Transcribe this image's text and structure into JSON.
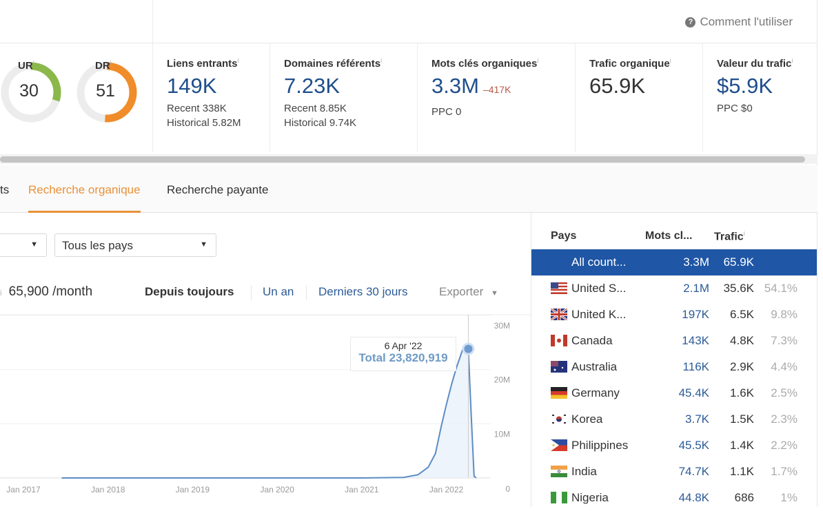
{
  "header": {
    "help_label": "Comment l'utiliser",
    "help_icon": "question-circle-icon"
  },
  "metrics": {
    "ur": {
      "label": "UR",
      "value": "30",
      "fraction": 0.3,
      "color": "#8bb84a"
    },
    "dr": {
      "label": "DR",
      "value": "51",
      "fraction": 0.51,
      "color": "#f08c2a"
    },
    "backlinks": {
      "label": "Liens entrants",
      "value": "149K",
      "recent": "Recent 338K",
      "historical": "Historical 5.82M"
    },
    "ref_domains": {
      "label": "Domaines référents",
      "value": "7.23K",
      "recent": "Recent 8.85K",
      "historical": "Historical 9.74K"
    },
    "organic_keywords": {
      "label": "Mots clés organiques",
      "value": "3.3M",
      "delta": "–417K",
      "ppc": "PPC 0"
    },
    "organic_traffic": {
      "label": "Trafic organique",
      "value": "65.9K"
    },
    "traffic_value": {
      "label": "Valeur du trafic",
      "value": "$5.9K",
      "ppc": "PPC $0"
    }
  },
  "tabs": [
    {
      "label": "ts"
    },
    {
      "label": "Recherche organique",
      "active": true
    },
    {
      "label": "Recherche payante"
    }
  ],
  "filters": {
    "country_select": "Tous les pays"
  },
  "summary": {
    "traffic": "65,900 /month"
  },
  "periods": {
    "all": "Depuis toujours",
    "year": "Un an",
    "days30": "Derniers 30 jours",
    "export": "Exporter"
  },
  "chart_data": {
    "type": "area",
    "x_tick_labels": [
      "Jan 2017",
      "Jan 2018",
      "Jan 2019",
      "Jan 2020",
      "Jan 2021",
      "Jan 2022"
    ],
    "y_tick_labels": [
      "0",
      "10M",
      "20M",
      "30M"
    ],
    "ylim": [
      0,
      30000000
    ],
    "grid": true,
    "color": "#5b8cc4",
    "tooltip": {
      "date": "6 Apr '22",
      "text": "Total 23,820,919"
    },
    "points": [
      [
        "2017-06-15",
        0
      ],
      [
        "2019-01-01",
        0
      ],
      [
        "2021-01-01",
        0
      ],
      [
        "2021-07-01",
        100000
      ],
      [
        "2021-09-01",
        600000
      ],
      [
        "2021-10-15",
        2000000
      ],
      [
        "2021-11-15",
        4500000
      ],
      [
        "2021-12-10",
        9500000
      ],
      [
        "2022-01-01",
        13500000
      ],
      [
        "2022-01-25",
        17500000
      ],
      [
        "2022-02-15",
        20500000
      ],
      [
        "2022-03-15",
        24000000
      ],
      [
        "2022-04-06",
        23820919
      ],
      [
        "2022-04-18",
        12000000
      ],
      [
        "2022-05-01",
        300000
      ],
      [
        "2022-05-10",
        0
      ]
    ]
  },
  "countries": {
    "headers": {
      "country": "Pays",
      "keywords": "Mots cl...",
      "traffic": "Trafic"
    },
    "rows": [
      {
        "name": "All count...",
        "keywords": "3.3M",
        "traffic": "65.9K",
        "pct": "",
        "flag": "none"
      },
      {
        "name": "United S...",
        "keywords": "2.1M",
        "traffic": "35.6K",
        "pct": "54.1%",
        "flag": "us"
      },
      {
        "name": "United K...",
        "keywords": "197K",
        "traffic": "6.5K",
        "pct": "9.8%",
        "flag": "uk"
      },
      {
        "name": "Canada",
        "keywords": "143K",
        "traffic": "4.8K",
        "pct": "7.3%",
        "flag": "ca"
      },
      {
        "name": "Australia",
        "keywords": "116K",
        "traffic": "2.9K",
        "pct": "4.4%",
        "flag": "au"
      },
      {
        "name": "Germany",
        "keywords": "45.4K",
        "traffic": "1.6K",
        "pct": "2.5%",
        "flag": "de"
      },
      {
        "name": "Korea",
        "keywords": "3.7K",
        "traffic": "1.5K",
        "pct": "2.3%",
        "flag": "kr"
      },
      {
        "name": "Philippines",
        "keywords": "45.5K",
        "traffic": "1.4K",
        "pct": "2.2%",
        "flag": "ph"
      },
      {
        "name": "India",
        "keywords": "74.7K",
        "traffic": "1.1K",
        "pct": "1.7%",
        "flag": "in"
      },
      {
        "name": "Nigeria",
        "keywords": "44.8K",
        "traffic": "686",
        "pct": "1%",
        "flag": "ng"
      }
    ]
  }
}
